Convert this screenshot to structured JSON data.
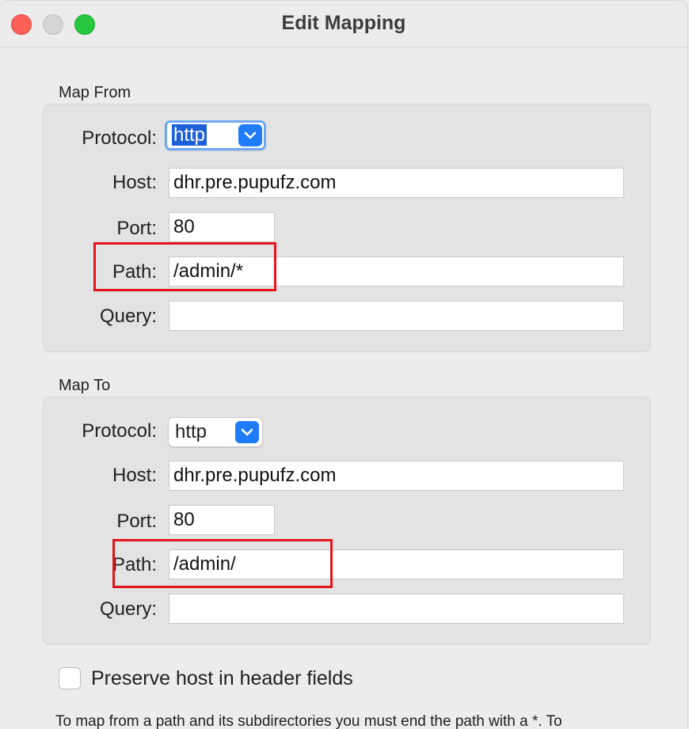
{
  "window": {
    "title": "Edit Mapping"
  },
  "map_from": {
    "section_label": "Map From",
    "protocol_label": "Protocol:",
    "protocol_value": "http",
    "host_label": "Host:",
    "host_value": "dhr.pre.pupufz.com",
    "port_label": "Port:",
    "port_value": "80",
    "path_label": "Path:",
    "path_value": "/admin/*",
    "query_label": "Query:",
    "query_value": ""
  },
  "map_to": {
    "section_label": "Map To",
    "protocol_label": "Protocol:",
    "protocol_value": "http",
    "host_label": "Host:",
    "host_value": "dhr.pre.pupufz.com",
    "port_label": "Port:",
    "port_value": "80",
    "path_label": "Path:",
    "path_value": "/admin/",
    "query_label": "Query:",
    "query_value": ""
  },
  "options": {
    "preserve_host_label": "Preserve host in header fields",
    "preserve_host_checked": false
  },
  "help_text": "To map from a path and its subdirectories you must end the path with a *. To",
  "colors": {
    "accent": "#1f7cf6",
    "annotation_red": "#e3141b",
    "selection": "#1c5fd6"
  },
  "icons": {
    "close": "close-window-icon",
    "minimize": "minimize-window-icon",
    "maximize": "maximize-window-icon",
    "dropdown": "chevron-down-icon"
  }
}
